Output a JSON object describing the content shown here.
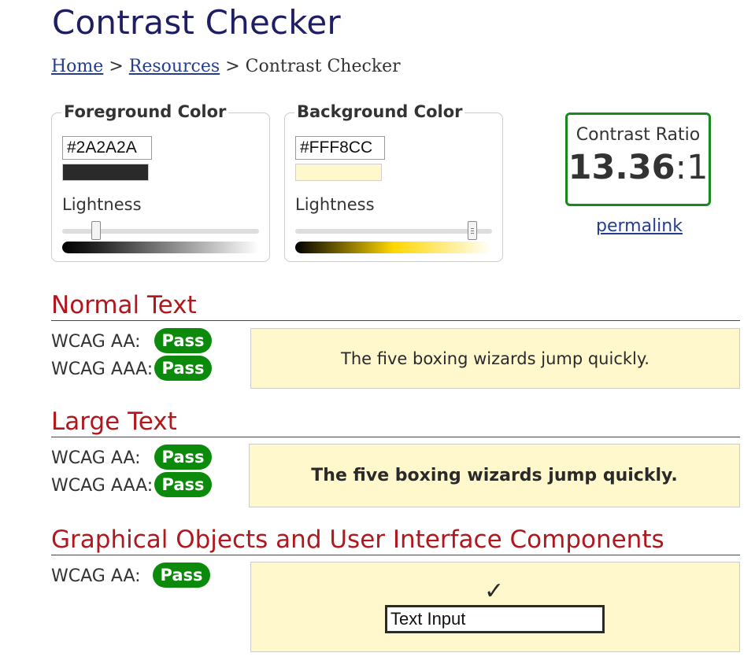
{
  "page": {
    "title": "Contrast Checker",
    "breadcrumb": {
      "home": "Home",
      "separator": ">",
      "resources": "Resources",
      "current": "Contrast Checker"
    }
  },
  "foreground": {
    "legend": "Foreground Color",
    "hex": "#2A2A2A",
    "swatch_color": "#2A2A2A",
    "lightness_label": "Lightness",
    "lightness_fraction": 0.17
  },
  "background": {
    "legend": "Background Color",
    "hex": "#FFF8CC",
    "swatch_color": "#FFF8CC",
    "lightness_label": "Lightness",
    "lightness_fraction": 0.9,
    "gradient_color": "#FFD700"
  },
  "contrast": {
    "label": "Contrast Ratio",
    "value": "13.36",
    "suffix": ":1",
    "permalink": "permalink",
    "border_color": "#18891F"
  },
  "sections": {
    "normal": {
      "heading": "Normal Text",
      "aa_label": "WCAG AA:",
      "aa_result": "Pass",
      "aaa_label": "WCAG AAA:",
      "aaa_result": "Pass",
      "sample": "The five boxing wizards jump quickly."
    },
    "large": {
      "heading": "Large Text",
      "aa_label": "WCAG AA:",
      "aa_result": "Pass",
      "aaa_label": "WCAG AAA:",
      "aaa_result": "Pass",
      "sample": "The five boxing wizards jump quickly."
    },
    "graphical": {
      "heading": "Graphical Objects and User Interface Components",
      "aa_label": "WCAG AA:",
      "aa_result": "Pass",
      "check_glyph": "✓",
      "input_value": "Text Input"
    }
  },
  "colors": {
    "pass": "#0B8A0B",
    "heading": "#B0181E",
    "title": "#1E1E64",
    "link": "#253D90"
  }
}
